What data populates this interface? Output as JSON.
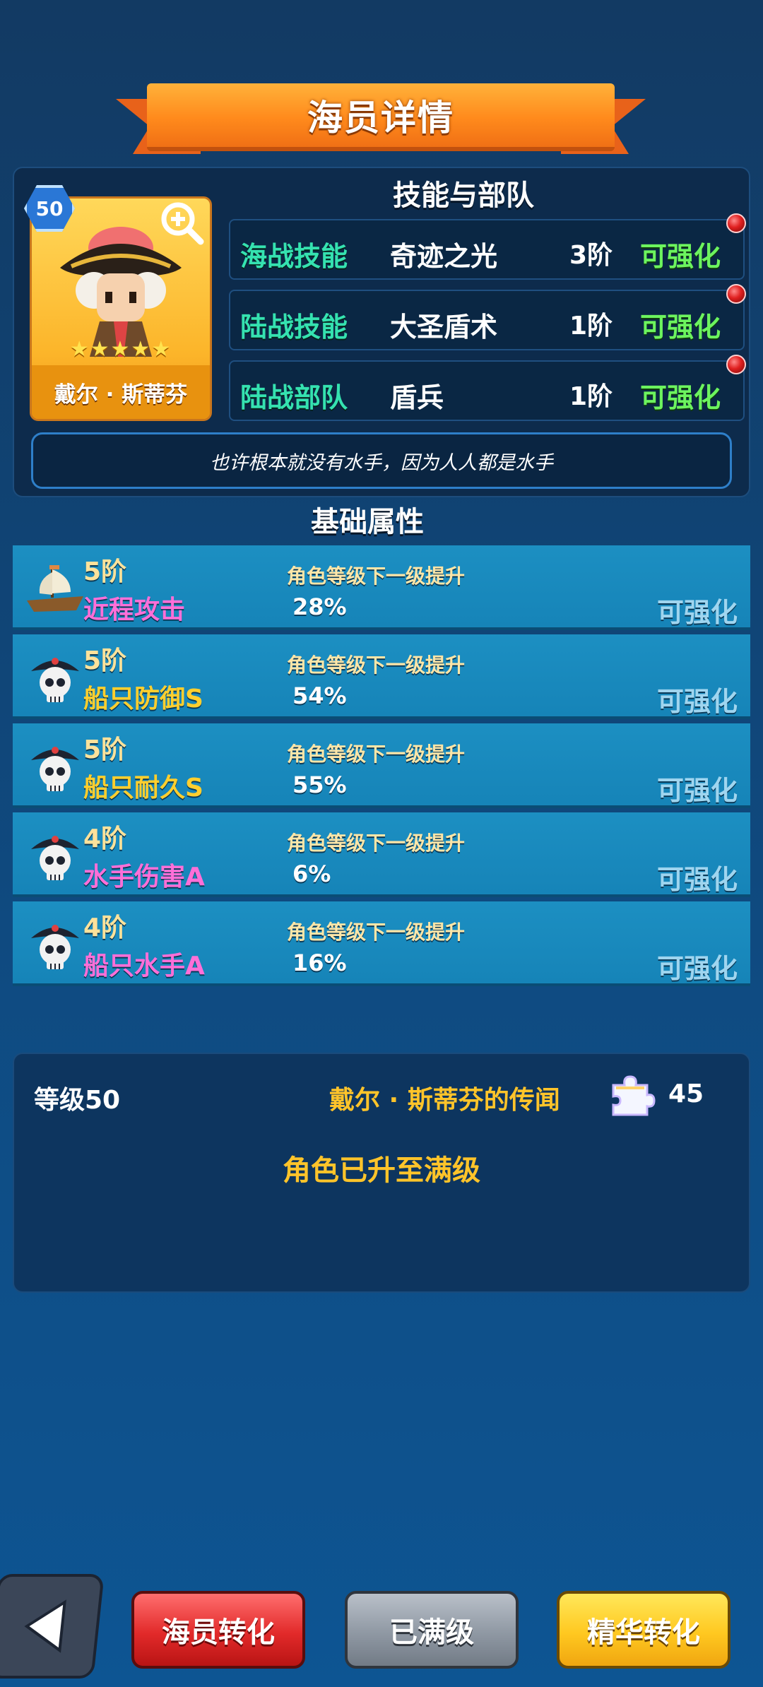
{
  "header": {
    "title": "海员详情"
  },
  "crew": {
    "level": "50",
    "name": "戴尔 · 斯蒂芬",
    "stars": "★★★★★",
    "quote": "也许根本就没有水手，因为人人都是水手"
  },
  "skills": {
    "section_title": "技能与部队",
    "rows": [
      {
        "category": "海战技能",
        "name": "奇迹之光",
        "tier": "3阶",
        "status": "可强化"
      },
      {
        "category": "陆战技能",
        "name": "大圣盾术",
        "tier": "1阶",
        "status": "可强化"
      },
      {
        "category": "陆战部队",
        "name": "盾兵",
        "tier": "1阶",
        "status": "可强化"
      }
    ]
  },
  "attributes": {
    "section_title": "基础属性",
    "rows": [
      {
        "tier": "5阶",
        "name": "近程攻击",
        "desc": "角色等级下一级提升",
        "value": "28%",
        "status": "可强化",
        "icon": "ship-icon",
        "name_color": "#ff6fd8"
      },
      {
        "tier": "5阶",
        "name": "船只防御S",
        "desc": "角色等级下一级提升",
        "value": "54%",
        "status": "可强化",
        "icon": "pirate-skull-icon",
        "name_color": "#ffcf2e"
      },
      {
        "tier": "5阶",
        "name": "船只耐久S",
        "desc": "角色等级下一级提升",
        "value": "55%",
        "status": "可强化",
        "icon": "pirate-skull-icon",
        "name_color": "#ffcf2e"
      },
      {
        "tier": "4阶",
        "name": "水手伤害A",
        "desc": "角色等级下一级提升",
        "value": "6%",
        "status": "可强化",
        "icon": "pirate-skull-icon",
        "name_color": "#ff6fd8"
      },
      {
        "tier": "4阶",
        "name": "船只水手A",
        "desc": "角色等级下一级提升",
        "value": "16%",
        "status": "可强化",
        "icon": "pirate-skull-icon",
        "name_color": "#ff6fd8"
      }
    ]
  },
  "info": {
    "level_label": "等级50",
    "lore_label": "戴尔 · 斯蒂芬的传闻",
    "lore_count": "45",
    "maxed_text": "角色已升至满级"
  },
  "buttons": {
    "convert": "海员转化",
    "maxed": "已满级",
    "essence": "精华转化"
  },
  "colors": {
    "accent_orange": "#ff8a1c",
    "skill_category": "#35e2b0",
    "upgrade_green": "#6cf45e",
    "gold_text": "#ffc42a"
  }
}
